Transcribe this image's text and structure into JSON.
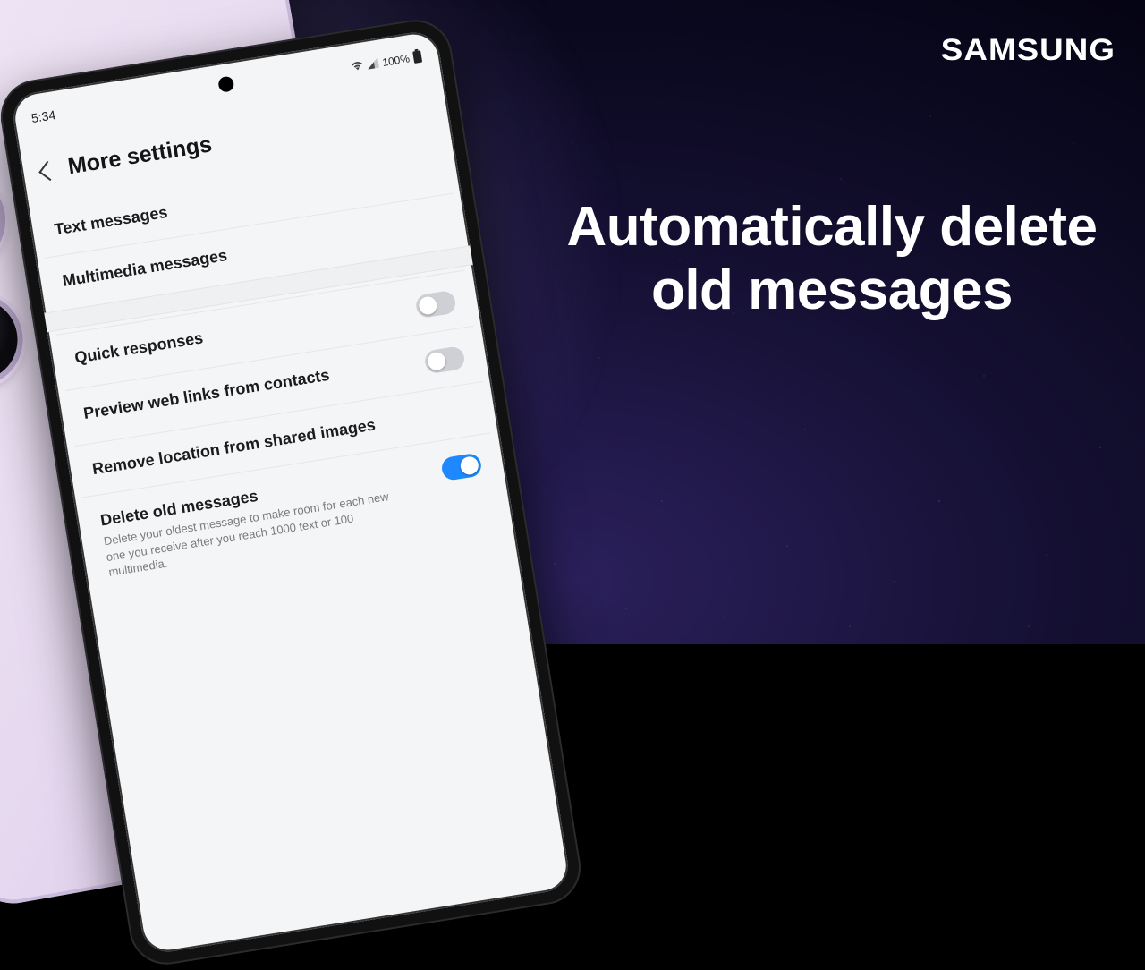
{
  "brand": "SAMSUNG",
  "headline": "Automatically delete old messages",
  "status": {
    "time": "5:34",
    "battery": "100%",
    "icons": {
      "wifi": "wifi-icon",
      "signal": "signal-icon",
      "battery": "battery-icon"
    }
  },
  "page": {
    "title": "More settings"
  },
  "group1": [
    {
      "label": "Text messages"
    },
    {
      "label": "Multimedia messages"
    }
  ],
  "group2": [
    {
      "label": "Quick responses",
      "toggle": false
    },
    {
      "label": "Preview web links from contacts",
      "toggle": false
    },
    {
      "label": "Remove location from shared images",
      "toggle": null
    },
    {
      "label": "Delete old messages",
      "desc": "Delete your oldest message to make room for each new one you receive after you reach 1000 text or 100 multimedia.",
      "toggle": true
    }
  ],
  "colors": {
    "accent": "#1e88ff"
  }
}
